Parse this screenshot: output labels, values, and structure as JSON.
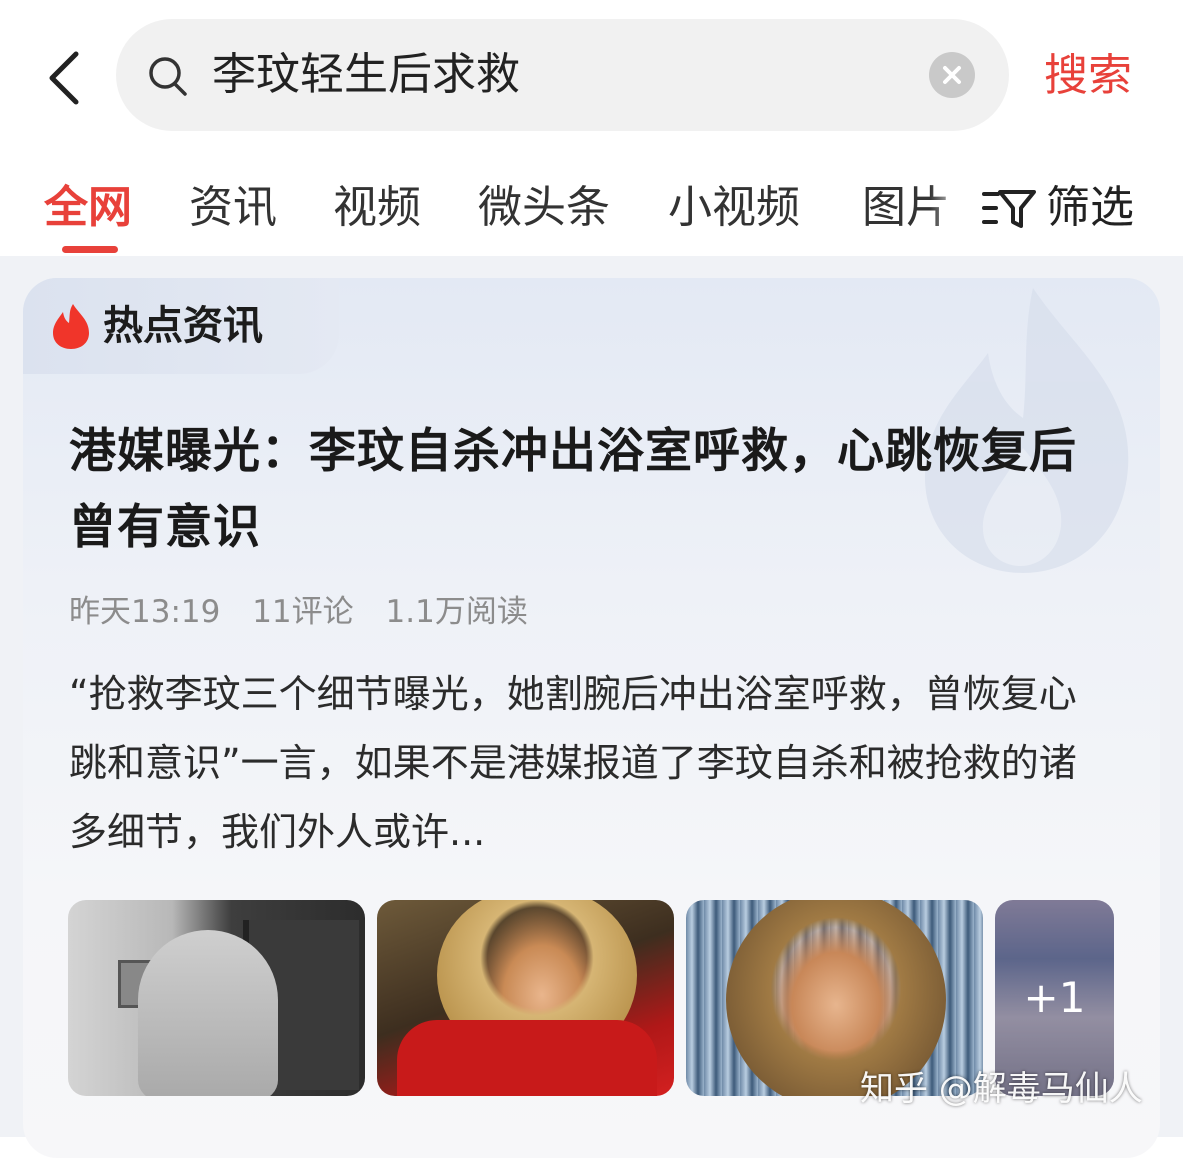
{
  "search": {
    "query": "李玟轻生后求救",
    "submit_label": "搜索"
  },
  "tabs": [
    {
      "label": "全网",
      "active": true
    },
    {
      "label": "资讯",
      "active": false
    },
    {
      "label": "视频",
      "active": false
    },
    {
      "label": "微头条",
      "active": false
    },
    {
      "label": "小视频",
      "active": false
    },
    {
      "label": "图片",
      "active": false
    }
  ],
  "filter": {
    "label": "筛选"
  },
  "hot_card": {
    "section_label": "热点资讯",
    "headline": "港媒曝光：李玟自杀冲出浴室呼救，心跳恢复后曾有意识",
    "meta": {
      "time": "昨天13:19",
      "comments": "11评论",
      "reads": "1.1万阅读"
    },
    "summary": "“抢救李玟三个细节曝光，她割腕后冲出浴室呼救，曾恢复心跳和意识”一言，如果不是港媒报道了李玟自杀和被抢救的诸多细节，我们外人或许...",
    "extra_images": "+1"
  },
  "watermark": "知乎 @解毒马仙人",
  "colors": {
    "accent": "#e8413a",
    "card_bg": "#e3e9f4"
  }
}
